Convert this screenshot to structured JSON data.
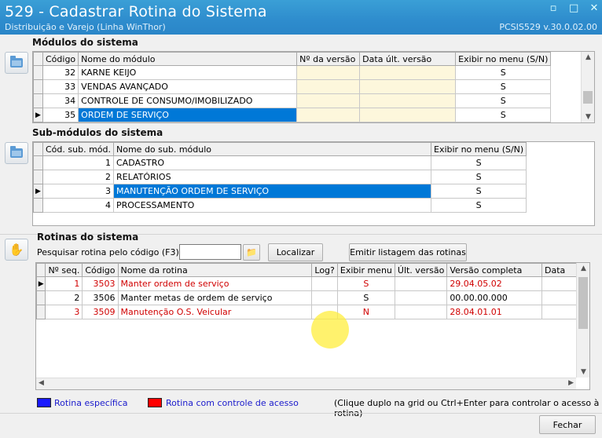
{
  "window": {
    "title": "529 - Cadastrar Rotina do Sistema",
    "subtitle": "Distribuição e Varejo (Linha WinThor)",
    "program": "PCSIS529  v.30.0.02.00",
    "controls": [
      "▫",
      "□",
      "✕"
    ]
  },
  "modulos": {
    "title": "Módulos do sistema",
    "columns": [
      "Código",
      "Nome do módulo",
      "Nº da versão",
      "Data últ. versão",
      "Exibir no menu (S/N)"
    ],
    "rows": [
      {
        "codigo": "32",
        "nome": "KARNE KEIJO",
        "versao": "",
        "data": "",
        "exibir": "S"
      },
      {
        "codigo": "33",
        "nome": "VENDAS AVANÇADO",
        "versao": "",
        "data": "",
        "exibir": "S"
      },
      {
        "codigo": "34",
        "nome": "CONTROLE DE CONSUMO/IMOBILIZADO",
        "versao": "",
        "data": "",
        "exibir": "S"
      },
      {
        "codigo": "35",
        "nome": "ORDEM DE SERVIÇO",
        "versao": "",
        "data": "",
        "exibir": "S"
      }
    ],
    "selected_index": 3
  },
  "submodulos": {
    "title": "Sub-módulos do sistema",
    "columns": [
      "Cód. sub. mód.",
      "Nome do sub. módulo",
      "Exibir no menu (S/N)"
    ],
    "rows": [
      {
        "codigo": "1",
        "nome": "CADASTRO",
        "exibir": "S"
      },
      {
        "codigo": "2",
        "nome": "RELATÓRIOS",
        "exibir": "S"
      },
      {
        "codigo": "3",
        "nome": "MANUTENÇÃO ORDEM DE SERVIÇO",
        "exibir": "S"
      },
      {
        "codigo": "4",
        "nome": "PROCESSAMENTO",
        "exibir": "S"
      }
    ],
    "selected_index": 2
  },
  "rotinas": {
    "title": "Rotinas do sistema",
    "search_label": "Pesquisar rotina pelo código (F3):",
    "search_value": "",
    "localizar_label": "Localizar",
    "emitir_label": "Emitir listagem das rotinas",
    "columns": [
      "Nº seq.",
      "Código",
      "Nome da rotina",
      "Log?",
      "Exibir menu",
      "Últ. versão",
      "Versão completa",
      "Data"
    ],
    "rows": [
      {
        "seq": "1",
        "codigo": "3503",
        "nome": "Manter ordem de serviço",
        "log": "",
        "exibir": "S",
        "ult": "",
        "versao": "29.04.05.02",
        "data": "",
        "restrita": true
      },
      {
        "seq": "2",
        "codigo": "3506",
        "nome": "Manter metas de ordem de serviço",
        "log": "",
        "exibir": "S",
        "ult": "",
        "versao": "00.00.00.000",
        "data": "",
        "restrita": false
      },
      {
        "seq": "3",
        "codigo": "3509",
        "nome": "Manutenção O.S. Veicular",
        "log": "",
        "exibir": "N",
        "ult": "",
        "versao": "28.04.01.01",
        "data": "",
        "restrita": true
      }
    ]
  },
  "legend": {
    "especifica": "Rotina específica",
    "especifica_color": "#1a1aff",
    "acesso": "Rotina com controle de acesso",
    "acesso_color": "#ff0000",
    "hint": "(Clique duplo na grid ou Ctrl+Enter para controlar o acesso à rotina)"
  },
  "fechar_label": "Fechar"
}
